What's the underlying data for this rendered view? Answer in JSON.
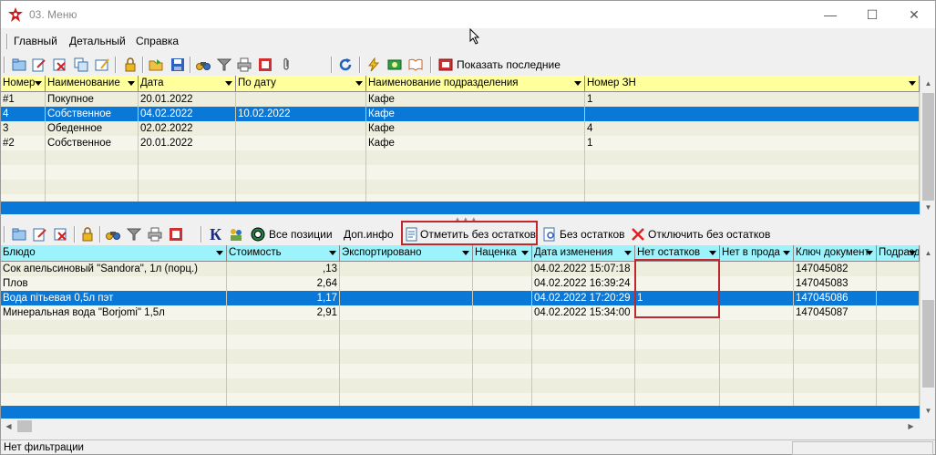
{
  "window": {
    "title": "03. Меню"
  },
  "menu": [
    "Главный",
    "Детальный",
    "Справка"
  ],
  "toolbar1": {
    "show_latest": "Показать последние"
  },
  "toolbar2": {
    "all_positions": "Все позиции",
    "extra_info": "Доп.инфо",
    "mark_no_stock": "Отметить без остатков",
    "no_stock": "Без остатков",
    "disable_no_stock": "Отключить без остатков",
    "k_letter": "К"
  },
  "top_grid": {
    "columns": [
      "Номер",
      "Наименование",
      "Дата",
      "По дату",
      "Наименование подразделения",
      "Номер ЗН"
    ],
    "rows": [
      [
        "#1",
        "Покупное",
        "20.01.2022",
        "",
        "Кафе",
        "1"
      ],
      [
        "4",
        "Собственное",
        "04.02.2022",
        "10.02.2022",
        "Кафе",
        ""
      ],
      [
        "3",
        "Обеденное",
        "02.02.2022",
        "",
        "Кафе",
        "4"
      ],
      [
        "#2",
        "Собственное",
        "20.01.2022",
        "",
        "Кафе",
        "1"
      ]
    ],
    "selected_row": 1
  },
  "bottom_grid": {
    "columns": [
      "Блюдо",
      "Стоимость",
      "Экспортировано",
      "Наценка",
      "Дата изменения",
      "Нет остатков",
      "Нет в прода",
      "Ключ документ",
      "Подразде"
    ],
    "rows": [
      [
        "Сок апельсиновый \"Sandora\", 1л (порц.)",
        ",13",
        "",
        "",
        "04.02.2022 15:07:18",
        "",
        "",
        "147045082",
        ""
      ],
      [
        "Плов",
        "2,64",
        "",
        "",
        "04.02.2022 16:39:24",
        "",
        "",
        "147045083",
        ""
      ],
      [
        "Вода пітьевая 0,5л пэт",
        "1,17",
        "",
        "",
        "04.02.2022 17:20:29",
        "1",
        "",
        "147045086",
        ""
      ],
      [
        "Минеральная вода \"Borjomi\" 1,5л",
        "2,91",
        "",
        "",
        "04.02.2022 15:34:00",
        "",
        "",
        "147045087",
        ""
      ]
    ],
    "selected_row": 2
  },
  "status": {
    "filter": "Нет фильтрации"
  },
  "colors": {
    "header_yellow": "#ffff9c",
    "header_cyan": "#9cf3fb",
    "selection": "#0a78d7",
    "grid_bg": "#eeeedf",
    "highlight_red": "#c0282e"
  }
}
